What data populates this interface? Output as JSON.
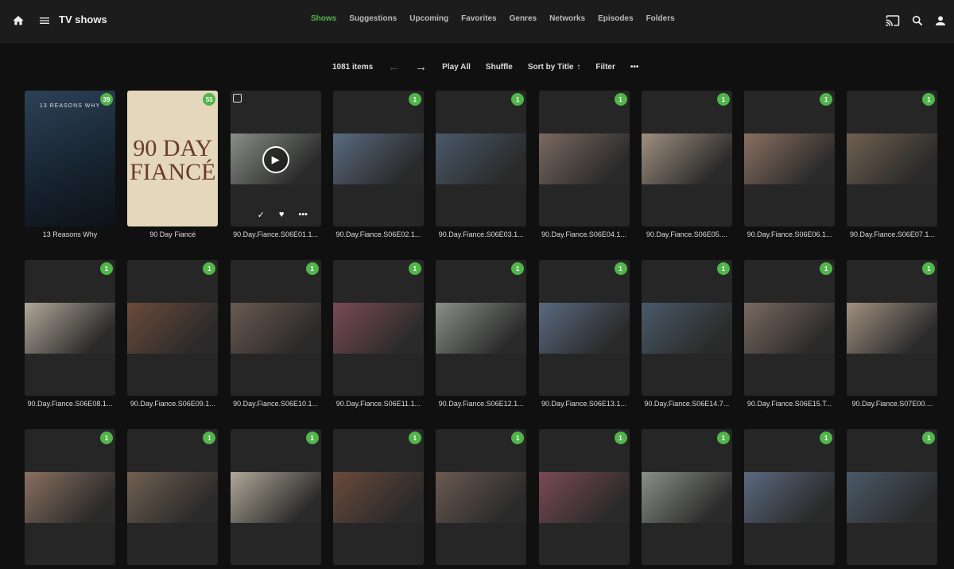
{
  "header": {
    "title": "TV shows",
    "tabs": [
      "Shows",
      "Suggestions",
      "Upcoming",
      "Favorites",
      "Genres",
      "Networks",
      "Episodes",
      "Folders"
    ],
    "active_tab": "Shows"
  },
  "toolbar": {
    "count": "1081 items",
    "play_all": "Play All",
    "shuffle": "Shuffle",
    "sort": "Sort by Title",
    "filter": "Filter"
  },
  "colors": {
    "accent": "#52b54b"
  },
  "posters": {
    "p1_text": "13 REASONS WHY",
    "p2_line1": "90 DAY",
    "p2_line2": "FIANCÉ"
  },
  "items": [
    {
      "title": "13 Reasons Why",
      "badge": "39"
    },
    {
      "title": "90 Day Fiancé",
      "badge": "55"
    },
    {
      "title": "90.Day.Fiance.S06E01.1...",
      "badge": "1"
    },
    {
      "title": "90.Day.Fiance.S06E02.1...",
      "badge": "1"
    },
    {
      "title": "90.Day.Fiance.S06E03.1...",
      "badge": "1"
    },
    {
      "title": "90.Day.Fiance.S06E04.1...",
      "badge": "1"
    },
    {
      "title": "90.Day.Fiance.S06E05....",
      "badge": "1"
    },
    {
      "title": "90.Day.Fiance.S06E06.1...",
      "badge": "1"
    },
    {
      "title": "90.Day.Fiance.S06E07.1...",
      "badge": "1"
    },
    {
      "title": "90.Day.Fiance.S06E08.1...",
      "badge": "1"
    },
    {
      "title": "90.Day.Fiance.S06E09.1...",
      "badge": "1"
    },
    {
      "title": "90.Day.Fiance.S06E10.1...",
      "badge": "1"
    },
    {
      "title": "90.Day.Fiance.S06E11.1...",
      "badge": "1"
    },
    {
      "title": "90.Day.Fiance.S06E12.1...",
      "badge": "1"
    },
    {
      "title": "90.Day.Fiance.S06E13.1...",
      "badge": "1"
    },
    {
      "title": "90.Day.Fiance.S06E14.7...",
      "badge": "1"
    },
    {
      "title": "90.Day.Fiance.S06E15.T...",
      "badge": "1"
    },
    {
      "title": "90.Day.Fiance.S07E00....",
      "badge": "1"
    },
    {
      "title": "",
      "badge": "1"
    },
    {
      "title": "",
      "badge": "1"
    },
    {
      "title": "",
      "badge": "1"
    },
    {
      "title": "",
      "badge": "1"
    },
    {
      "title": "",
      "badge": "1"
    },
    {
      "title": "",
      "badge": "1"
    },
    {
      "title": "",
      "badge": "1"
    },
    {
      "title": "",
      "badge": "1"
    },
    {
      "title": "",
      "badge": "1"
    }
  ]
}
